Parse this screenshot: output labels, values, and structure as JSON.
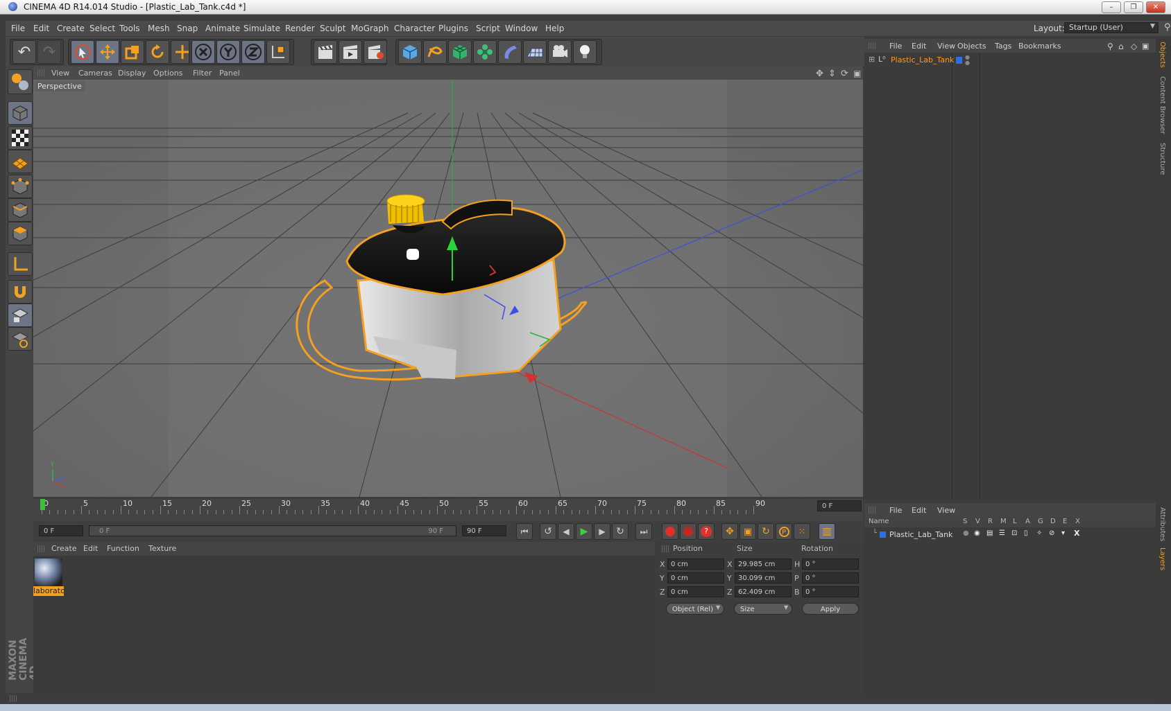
{
  "window": {
    "title": "CINEMA 4D R14.014 Studio - [Plastic_Lab_Tank.c4d *]"
  },
  "menubar": {
    "items": [
      "File",
      "Edit",
      "Create",
      "Select",
      "Tools",
      "Mesh",
      "Snap",
      "Animate",
      "Simulate",
      "Render",
      "Sculpt",
      "MoGraph",
      "Character",
      "Plugins",
      "Script",
      "Window",
      "Help"
    ],
    "layout_label": "Layout:",
    "layout_value": "Startup (User)"
  },
  "viewport": {
    "menu": [
      "View",
      "Cameras",
      "Display",
      "Options",
      "Filter",
      "Panel"
    ],
    "camera_label": "Perspective"
  },
  "timeline": {
    "ticks": [
      "0",
      "5",
      "10",
      "15",
      "20",
      "25",
      "30",
      "35",
      "40",
      "45",
      "50",
      "55",
      "60",
      "65",
      "70",
      "75",
      "80",
      "85",
      "90"
    ],
    "current_frame": "0 F",
    "start_field": "0 F",
    "range_start": "0 F",
    "range_end": "90 F",
    "end_field": "90 F"
  },
  "material_panel": {
    "menu": [
      "Create",
      "Edit",
      "Function",
      "Texture"
    ],
    "material_name": "laborato"
  },
  "coordinates": {
    "headers": {
      "position": "Position",
      "size": "Size",
      "rotation": "Rotation"
    },
    "rows": [
      {
        "axis": "X",
        "pos": "0 cm",
        "size_axis": "X",
        "size": "29.985 cm",
        "rot_axis": "H",
        "rot": "0 °"
      },
      {
        "axis": "Y",
        "pos": "0 cm",
        "size_axis": "Y",
        "size": "30.099 cm",
        "rot_axis": "P",
        "rot": "0 °"
      },
      {
        "axis": "Z",
        "pos": "0 cm",
        "size_axis": "Z",
        "size": "62.409 cm",
        "rot_axis": "B",
        "rot": "0 °"
      }
    ],
    "mode_dropdown": "Object (Rel)",
    "size_dropdown": "Size",
    "apply_label": "Apply"
  },
  "object_manager": {
    "menu": [
      "File",
      "Edit",
      "View",
      "Objects",
      "Tags",
      "Bookmarks"
    ],
    "object_name": "Plastic_Lab_Tank",
    "object_color": "#ff9a1f"
  },
  "layer_manager": {
    "menu": [
      "File",
      "Edit",
      "View"
    ],
    "columns": [
      "Name",
      "S",
      "V",
      "R",
      "M",
      "L",
      "A",
      "G",
      "D",
      "E",
      "X"
    ],
    "layer_name": "Plastic_Lab_Tank"
  },
  "side_tabs": [
    "Objects",
    "Content Browser",
    "Structure",
    "Attributes",
    "Layers"
  ],
  "branding": "MAXON CINEMA 4D",
  "colors": {
    "accent": "#ff9a1f",
    "selection": "#f4a020"
  }
}
